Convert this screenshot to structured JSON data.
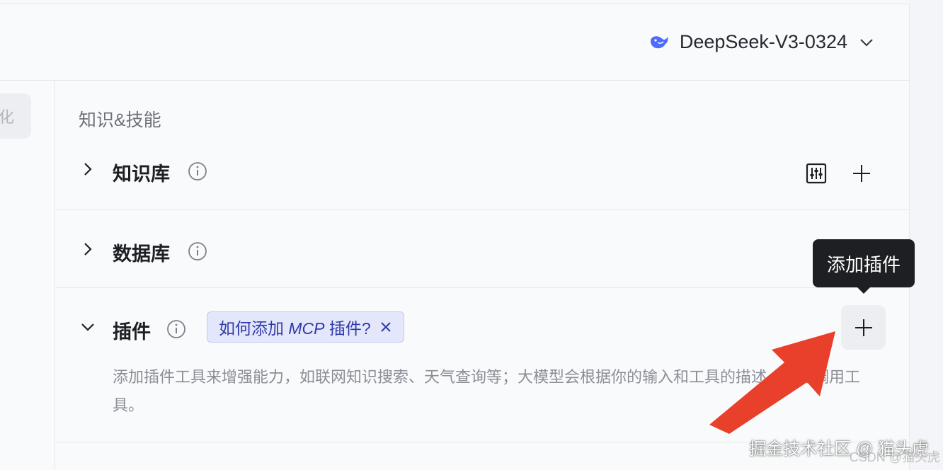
{
  "header": {
    "model_name": "DeepSeek-V3-0324",
    "model_icon": "deepseek-whale-icon"
  },
  "left_chip": {
    "text": "化"
  },
  "section": {
    "title": "知识&技能",
    "rows": [
      {
        "label": "知识库",
        "expanded": false
      },
      {
        "label": "数据库",
        "expanded": false
      },
      {
        "label": "插件",
        "expanded": true
      }
    ]
  },
  "plugin": {
    "tag_prefix": "如何添加 ",
    "tag_mcp": "MCP",
    "tag_suffix": " 插件?",
    "description": "添加插件工具来增强能力，如联网知识搜索、天气查询等；大模型会根据你的输入和工具的描述，智能调用工具。",
    "tooltip": "添加插件"
  },
  "colors": {
    "annotation_arrow": "#e8402a",
    "tag_background": "#e4e6fb",
    "tag_text": "#2f3aa8"
  },
  "watermark": {
    "main": "掘金技术社区 @ 猫头虎",
    "sub": "CSDN @猫头虎"
  }
}
